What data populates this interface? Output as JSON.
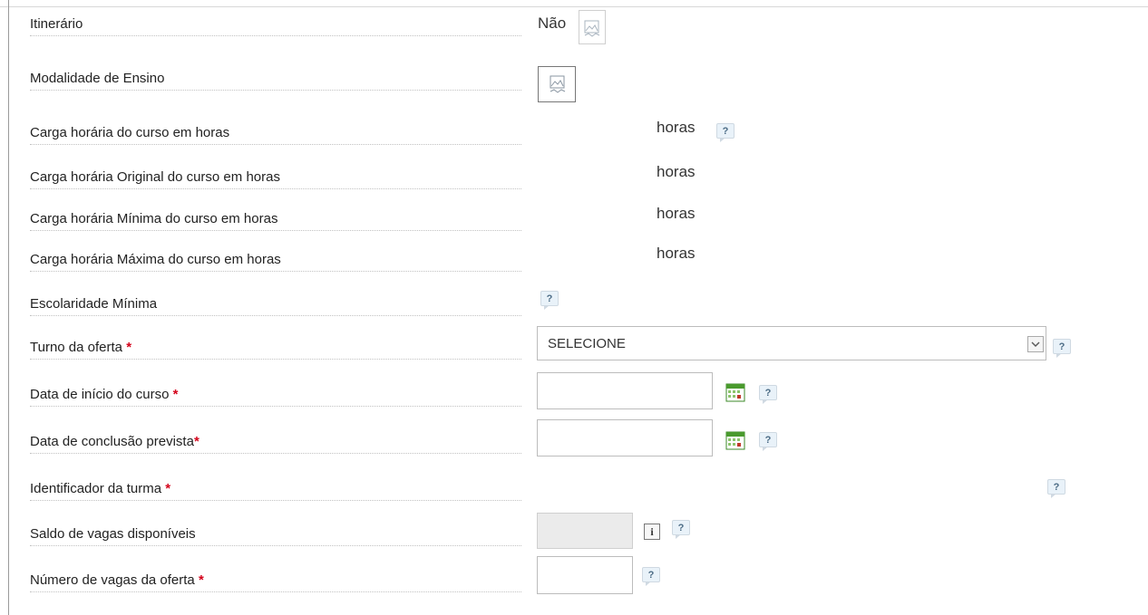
{
  "form": {
    "rows": [
      {
        "label": "Itinerário",
        "value": "Não"
      },
      {
        "label": "Modalidade de Ensino"
      },
      {
        "label": "Carga horária do curso em horas",
        "unit": "horas",
        "help": "?"
      },
      {
        "label": "Carga horária Original do curso em horas",
        "unit": "horas"
      },
      {
        "label": "Carga horária Mínima do curso em horas",
        "unit": "horas"
      },
      {
        "label": "Carga horária Máxima do curso em horas",
        "unit": "horas"
      },
      {
        "label": "Escolaridade Mínima",
        "help": "?"
      },
      {
        "label": "Turno da oferta",
        "required": "*",
        "select_value": "SELECIONE",
        "help": "?"
      },
      {
        "label": "Data de início do curso",
        "required": "*",
        "help": "?"
      },
      {
        "label": "Data de conclusão prevista",
        "required": "*",
        "help": "?"
      },
      {
        "label": "Identificador da turma",
        "required": "*",
        "help": "?"
      },
      {
        "label": "Saldo de vagas disponíveis",
        "info": "i",
        "help": "?"
      },
      {
        "label": "Número de vagas da oferta",
        "required": "*",
        "help": "?"
      }
    ]
  },
  "icons": {
    "image_placeholder": "broken-image-icon",
    "calendar": "calendar-icon",
    "help": "help-icon",
    "info": "info-icon",
    "dropdown": "chevron-down-icon"
  },
  "colors": {
    "required_asterisk": "#d4001a",
    "help_bg": "#e9f2f9",
    "calendar_green": "#4a9a2e"
  }
}
